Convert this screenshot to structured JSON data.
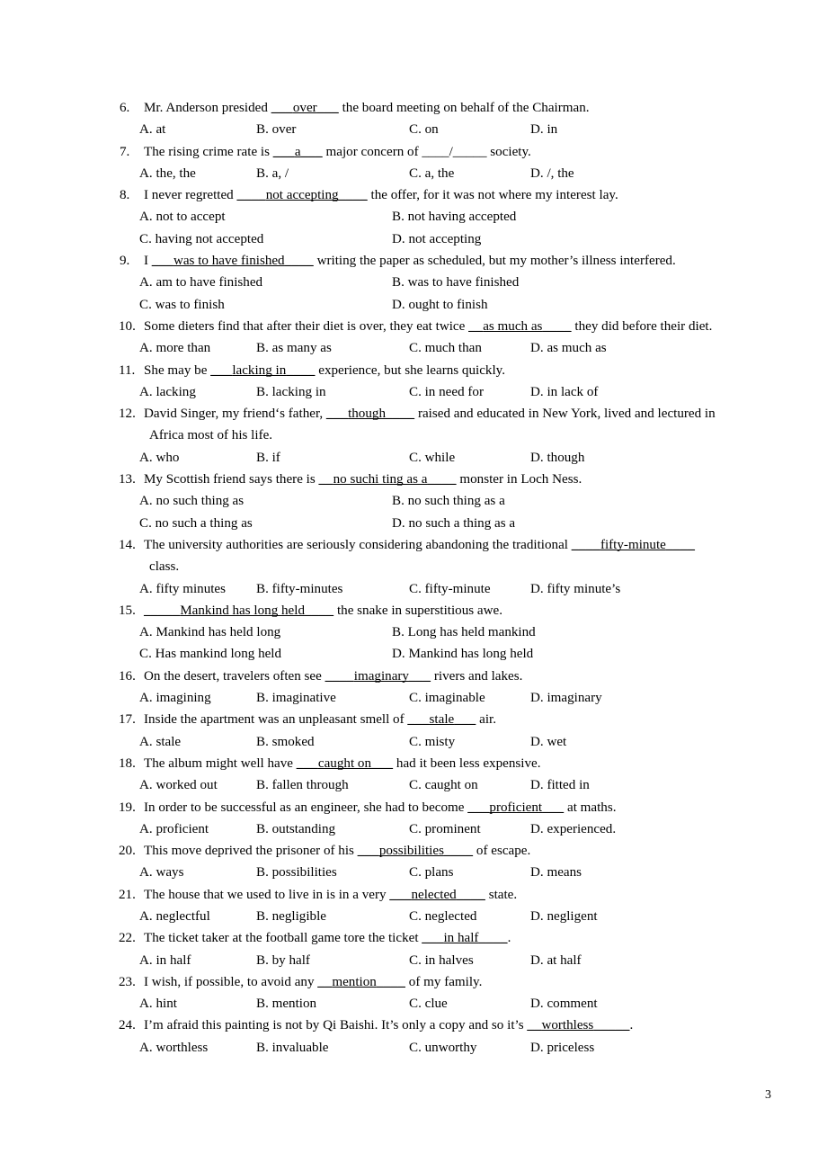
{
  "document": {
    "page_number": "3",
    "type": "multiple-choice-exam"
  },
  "questions": [
    {
      "number": "6.",
      "stem_before": "Mr. Anderson presided ",
      "blank_left": "___",
      "blank_word": "over",
      "blank_right": "___",
      "stem_after": " the board meeting on behalf of the Chairman.",
      "layout": "four",
      "options": [
        "A. at",
        "B. over",
        "C. on",
        "D. in"
      ]
    },
    {
      "number": "7.",
      "stem_before": "The rising crime rate is ",
      "blank_left": "___",
      "blank_word": "a",
      "blank_right": "___",
      "stem_after": " major concern of ____/_____ society.",
      "layout": "four",
      "options": [
        "A. the, the",
        "B. a, /",
        "C. a, the",
        "D. /, the"
      ]
    },
    {
      "number": "8.",
      "stem_before": "I never regretted ",
      "blank_left": "____",
      "blank_word": "not accepting",
      "blank_right": "____",
      "stem_after": " the offer, for it was not where my interest lay.",
      "layout": "two",
      "options": [
        "A. not to accept",
        "B. not having accepted",
        "C. having not accepted",
        "D. not accepting"
      ]
    },
    {
      "number": "9.",
      "stem_before": "I ",
      "blank_left": "___",
      "blank_word": "was to have finished",
      "blank_right": "____",
      "stem_after": " writing the paper as scheduled, but my mother’s illness interfered.",
      "layout": "two",
      "options": [
        "A. am to have finished",
        "B. was to have finished",
        "C. was to finish",
        "D. ought to finish"
      ]
    },
    {
      "number": "10.",
      "stem_before": "Some dieters find that after their diet is over, they eat twice ",
      "blank_left": "__",
      "blank_word": "as much as",
      "blank_right": "____",
      "stem_after": " they did before their diet.",
      "layout": "four",
      "options": [
        "A. more than",
        "B. as many as",
        "C. much than",
        "D. as much as"
      ]
    },
    {
      "number": "11.",
      "stem_before": "She may be ",
      "blank_left": "___",
      "blank_word": "lacking in",
      "blank_right": "____",
      "stem_after": " experience, but she learns quickly.",
      "layout": "four",
      "options": [
        "A. lacking",
        "B. lacking in",
        "C. in need for",
        "D. in lack of"
      ]
    },
    {
      "number": "12.",
      "stem_before": "David Singer, my friend‘s father, ",
      "blank_left": "___",
      "blank_word": "though",
      "blank_right": "____",
      "stem_after": " raised and educated in New York, lived and lectured in",
      "continuation": "Africa most of his life.",
      "layout": "four",
      "options": [
        "A. who",
        "B. if",
        "C. while",
        "D. though"
      ]
    },
    {
      "number": "13.",
      "stem_before": "My Scottish friend says there is ",
      "blank_left": "__",
      "blank_word": "no suchi ting as a",
      "blank_right": "____",
      "stem_after": " monster in Loch Ness.",
      "layout": "two",
      "options": [
        "A. no such thing as",
        "B. no such thing as a",
        "C. no such a thing as",
        "D. no such a thing as a"
      ]
    },
    {
      "number": "14.",
      "stem_before": "The university authorities are seriously considering abandoning the traditional ",
      "blank_left": "____",
      "blank_word": "fifty-minute",
      "blank_right": "____",
      "stem_after": "",
      "continuation": "class.",
      "justify": true,
      "layout": "four",
      "options": [
        "A. fifty minutes",
        "B. fifty-minutes",
        "C. fifty-minute",
        "D. fifty minute’s"
      ]
    },
    {
      "number": "15.",
      "stem_before": " ",
      "blank_left": "_____",
      "blank_word": "Mankind has long held",
      "blank_right": "____",
      "stem_after": " the snake in superstitious awe.",
      "layout": "two",
      "options": [
        "A. Mankind has held long",
        "B. Long has held mankind",
        "C. Has mankind long held",
        "D. Mankind has long held"
      ]
    },
    {
      "number": "16.",
      "stem_before": "On the desert, travelers often see ",
      "blank_left": "____",
      "blank_word": "imaginary",
      "blank_right": "___",
      "stem_after": " rivers and lakes.",
      "layout": "four",
      "options": [
        "A. imagining",
        "B. imaginative",
        "C. imaginable",
        "D. imaginary"
      ]
    },
    {
      "number": "17.",
      "stem_before": "Inside the apartment was an unpleasant smell of ",
      "blank_left": "___",
      "blank_word": "stale",
      "blank_right": "___",
      "stem_after": " air.",
      "layout": "four",
      "options": [
        "A. stale",
        "B. smoked",
        "C. misty",
        "D. wet"
      ]
    },
    {
      "number": "18.",
      "stem_before": "The album might well have ",
      "blank_left": "___",
      "blank_word": "caught on",
      "blank_right": "___",
      "stem_after": " had it been less expensive.",
      "layout": "four",
      "options": [
        "A. worked out",
        "B. fallen through",
        "C. caught on",
        "D. fitted in"
      ]
    },
    {
      "number": "19.",
      "stem_before": "In order to be successful as an engineer, she had to become ",
      "blank_left": "___",
      "blank_word": "proficient",
      "blank_right": "___",
      "stem_after": " at maths.",
      "layout": "four",
      "options": [
        "A. proficient",
        "B. outstanding",
        "C. prominent",
        "D. experienced."
      ]
    },
    {
      "number": "20.",
      "stem_before": "This move deprived the prisoner of his ",
      "blank_left": "___",
      "blank_word": "possibilities",
      "blank_right": "____",
      "stem_after": " of escape.",
      "layout": "four",
      "options": [
        "A. ways",
        "B. possibilities",
        "C. plans",
        "D. means"
      ]
    },
    {
      "number": "21.",
      "stem_before": "The house that we used to live in is in a very ",
      "blank_left": "___",
      "blank_word": "nelected",
      "blank_right": "____",
      "stem_after": " state.",
      "layout": "four",
      "options": [
        "A. neglectful",
        "B. negligible",
        "C. neglected",
        "D. negligent"
      ]
    },
    {
      "number": "22.",
      "stem_before": "The ticket taker at the football game tore the ticket ",
      "blank_left": "___",
      "blank_word": "in half",
      "blank_right": "____",
      "stem_after": ".",
      "layout": "four",
      "options": [
        "A. in half",
        "B. by half",
        "C. in halves",
        "D. at half"
      ]
    },
    {
      "number": "23.",
      "stem_before": "I wish, if possible, to avoid any ",
      "blank_left": "__",
      "blank_word": "mention",
      "blank_right": "____",
      "stem_after": " of my family.",
      "layout": "four",
      "options": [
        "A. hint",
        "B. mention",
        "C. clue",
        "D. comment"
      ]
    },
    {
      "number": "24.",
      "stem_before": "I’m afraid this painting is not by Qi Baishi. It’s only a copy and so it’s ",
      "blank_left": "__",
      "blank_word": "worthless",
      "blank_right": "_____",
      "stem_after": ".",
      "layout": "four",
      "options": [
        "A. worthless",
        "B. invaluable",
        "C. unworthy",
        "D. priceless"
      ]
    }
  ]
}
